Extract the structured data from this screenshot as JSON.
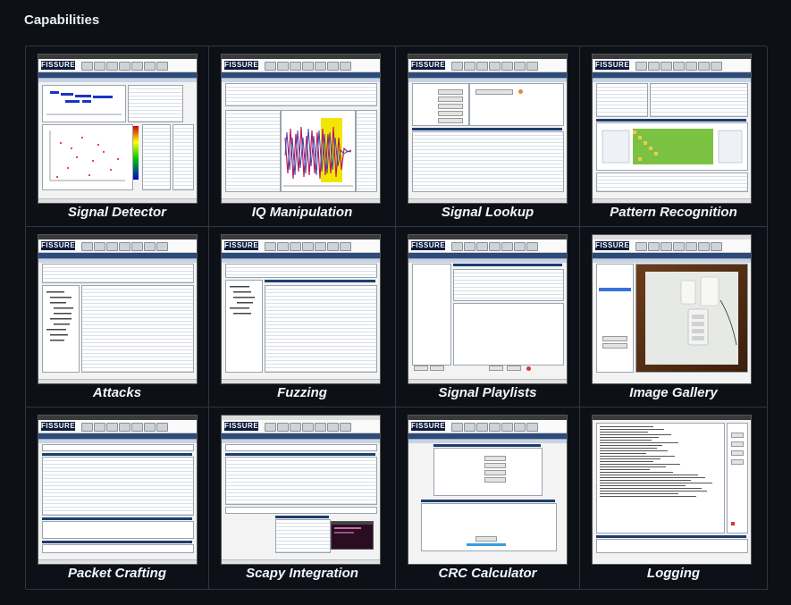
{
  "section_title": "Capabilities",
  "logo_text": "FISSURE",
  "tiles": [
    {
      "id": "signal-detector",
      "caption": "Signal Detector"
    },
    {
      "id": "iq-manipulation",
      "caption": "IQ Manipulation"
    },
    {
      "id": "signal-lookup",
      "caption": "Signal Lookup"
    },
    {
      "id": "pattern-recognition",
      "caption": "Pattern Recognition"
    },
    {
      "id": "attacks",
      "caption": "Attacks"
    },
    {
      "id": "fuzzing",
      "caption": "Fuzzing"
    },
    {
      "id": "signal-playlists",
      "caption": "Signal Playlists"
    },
    {
      "id": "image-gallery",
      "caption": "Image Gallery"
    },
    {
      "id": "packet-crafting",
      "caption": "Packet Crafting"
    },
    {
      "id": "scapy-integration",
      "caption": "Scapy Integration"
    },
    {
      "id": "crc-calculator",
      "caption": "CRC Calculator"
    },
    {
      "id": "logging",
      "caption": "Logging"
    }
  ],
  "colors": {
    "page_background": "#0d1117",
    "grid_border": "#30363d",
    "fissure_logo_bg": "#0d1b3e",
    "app_tab_bar": "#2d4a7a",
    "waveform_a": "#c2185b",
    "waveform_b": "#3949ab",
    "waveform_highlight": "#f2e600",
    "pattern_green": "#7cc242"
  }
}
